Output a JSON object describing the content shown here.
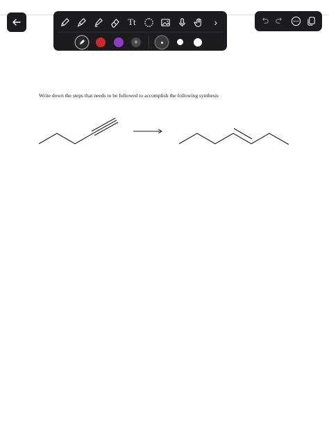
{
  "navigation": {
    "back_icon": "arrow-left-icon"
  },
  "toolbar": {
    "tools": [
      {
        "name": "pen",
        "icon": "pen-icon"
      },
      {
        "name": "marker",
        "icon": "marker-icon"
      },
      {
        "name": "highlighter",
        "icon": "highlighter-icon"
      },
      {
        "name": "eraser",
        "icon": "eraser-icon"
      },
      {
        "name": "text",
        "label": "Tt"
      },
      {
        "name": "shapes",
        "icon": "shapes-icon"
      },
      {
        "name": "image",
        "icon": "image-icon"
      },
      {
        "name": "microphone",
        "icon": "microphone-icon"
      },
      {
        "name": "hand",
        "icon": "hand-icon"
      },
      {
        "name": "more",
        "label": "›"
      }
    ],
    "colors": [
      {
        "name": "black",
        "hex": "#1c1c1e",
        "selected": true
      },
      {
        "name": "red",
        "hex": "#d0282a",
        "selected": false
      },
      {
        "name": "purple",
        "hex": "#8a3ec8",
        "selected": false
      }
    ],
    "add_color_label": "+",
    "sizes": [
      "small",
      "medium",
      "large"
    ],
    "selected_size": "small"
  },
  "right_panel": {
    "icons": [
      "undo-icon",
      "redo-icon",
      "more-options-icon",
      "pages-icon"
    ]
  },
  "document": {
    "question": "Write down the steps that needs to be followed to accomplish the following synthesis"
  },
  "colors": {
    "toolbar_bg": "#1c1c1e",
    "page_bg": "#ffffff",
    "ink": "#1a1a1a"
  }
}
